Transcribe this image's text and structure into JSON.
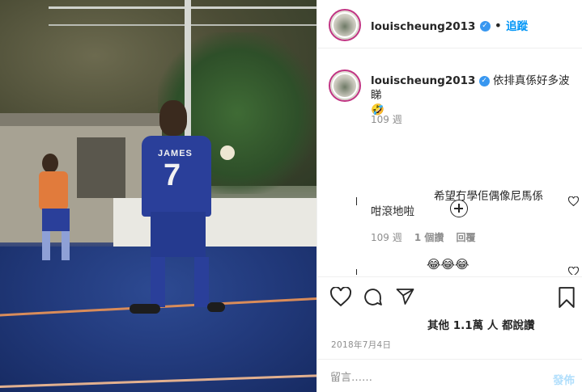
{
  "header": {
    "username": "louischeung2013",
    "follow_label": "追蹤",
    "separator": "•"
  },
  "photo": {
    "jersey_name": "JAMES",
    "jersey_number": "7"
  },
  "caption": {
    "username": "louischeung2013",
    "text_line1": "依排真係好多波睇",
    "text_line2": "🤣",
    "age": "109 週"
  },
  "comments": [
    {
      "text_line1": "希望冇學佢偶像尼馬係",
      "text_line2": "咁滾地啦",
      "age": "109 週",
      "likes": "1 個讚",
      "reply_label": "回覆"
    },
    {
      "text_line1": "😂😂😂"
    }
  ],
  "likes": {
    "text": "其他 1.1萬 人 都說讚"
  },
  "post_date": "2018年7月4日",
  "comment_bar": {
    "placeholder": "留言……",
    "post_label": "發佈"
  },
  "colors": {
    "accent": "#0095f6",
    "verified": "#3897f0",
    "post_disabled": "#b2dffc",
    "muted": "#8e8e8e"
  },
  "icons": [
    "verified-badge-icon",
    "heart-icon",
    "comment-icon",
    "share-icon",
    "bookmark-icon",
    "load-more-comments-icon",
    "comment-like-icon"
  ]
}
